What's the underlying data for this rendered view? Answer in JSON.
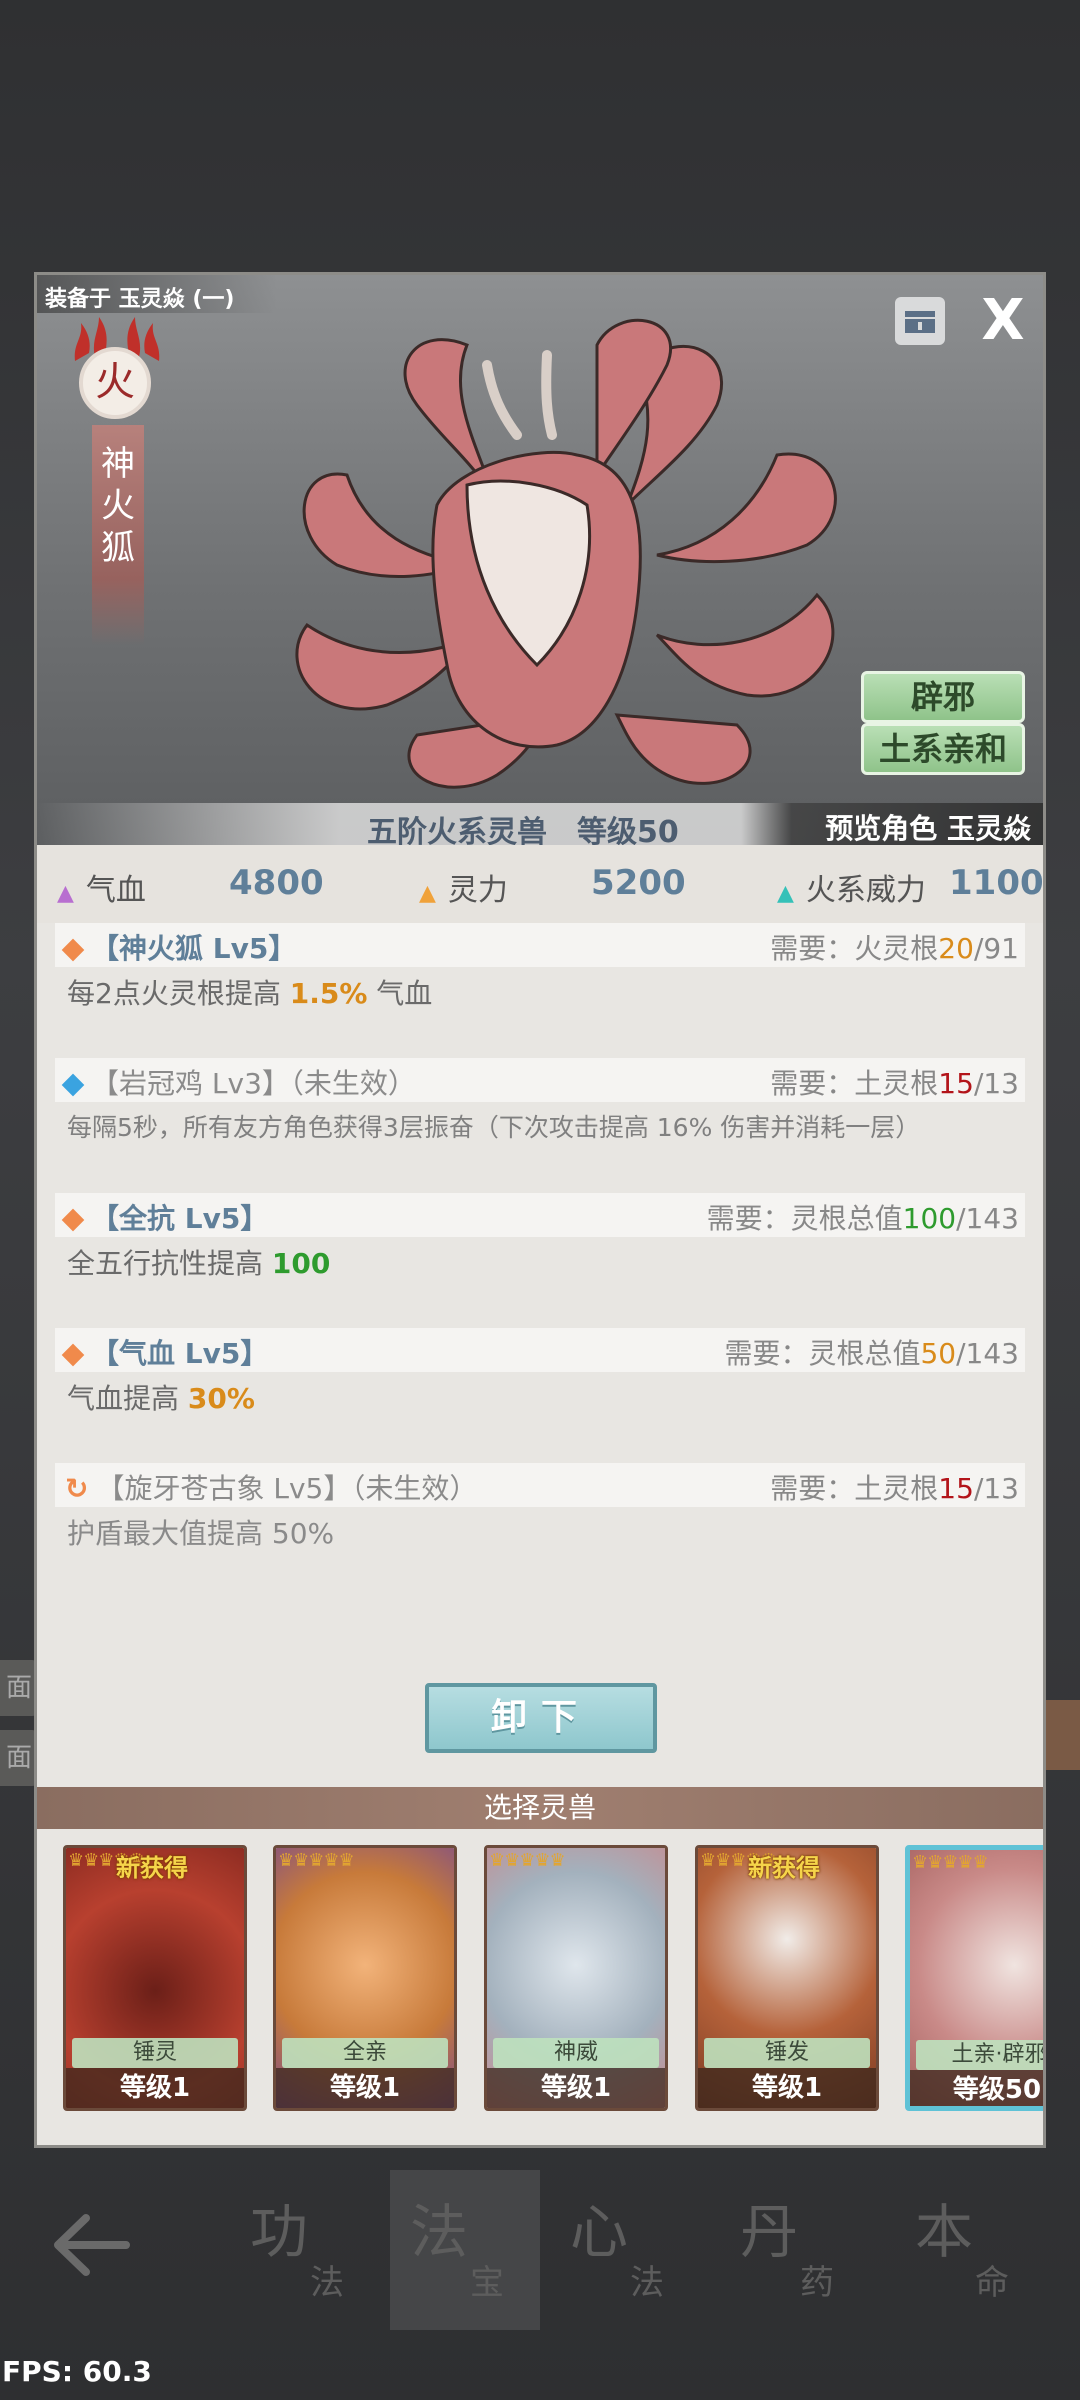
{
  "background": {
    "left_tabs": [
      "面",
      "面"
    ]
  },
  "bottom_nav": {
    "tabs": [
      {
        "big": "功",
        "small": "法"
      },
      {
        "big": "法",
        "small": "宝"
      },
      {
        "big": "心",
        "small": "法"
      },
      {
        "big": "丹",
        "small": "药"
      },
      {
        "big": "本",
        "small": "命"
      }
    ]
  },
  "fps": "FPS: 60.3",
  "modal": {
    "equipped_on": "装备于 玉灵焱 (一)",
    "close_glyph": "X",
    "element": "火",
    "beast_name_chars": [
      "神",
      "火",
      "狐"
    ],
    "traits": [
      "辟邪",
      "土系亲和"
    ],
    "rank_text": "五阶火系灵兽",
    "level_text": "等级50",
    "preview_role": "预览角色 玉灵焱"
  },
  "stats": [
    {
      "label": "气血",
      "value": "4800",
      "color": "#b86fd0"
    },
    {
      "label": "灵力",
      "value": "5200",
      "color": "#f0a23a"
    },
    {
      "label": "火系威力",
      "value": "1100",
      "color": "#35c1b8"
    }
  ],
  "skills": [
    {
      "name": "【神火狐 Lv5】",
      "inactive": "",
      "icon_color": "#f08a4b",
      "req_label": "需要：火灵根",
      "req_cur": "20",
      "req_max": "/91",
      "req_state": "ok",
      "desc_pre": "每2点火灵根提高 ",
      "desc_hl": "1.5%",
      "desc_post": " 气血",
      "hl_color": "orange"
    },
    {
      "name": "【岩冠鸡 Lv3】",
      "inactive": "（未生效）",
      "icon_color": "#3aa3e0",
      "req_label": "需要：土灵根",
      "req_cur": "15",
      "req_max": "/13",
      "req_state": "bad",
      "desc_pre": "每隔5秒，所有友方角色获得3层振奋（下次攻击提高 16% 伤害并消耗一层）",
      "desc_hl": "",
      "desc_post": "",
      "hl_color": "none"
    },
    {
      "name": "【全抗 Lv5】",
      "inactive": "",
      "icon_color": "#f08a4b",
      "req_label": "需要：灵根总值",
      "req_cur": "100",
      "req_max": "/143",
      "req_state": "green",
      "desc_pre": "全五行抗性提高 ",
      "desc_hl": "100",
      "desc_post": "",
      "hl_color": "green"
    },
    {
      "name": "【气血 Lv5】",
      "inactive": "",
      "icon_color": "#f08a4b",
      "req_label": "需要：灵根总值",
      "req_cur": "50",
      "req_max": "/143",
      "req_state": "ok",
      "desc_pre": "气血提高 ",
      "desc_hl": "30%",
      "desc_post": "",
      "hl_color": "orange"
    },
    {
      "name": "【旋牙苍古象 Lv5】",
      "inactive": "（未生效）",
      "icon_color": "#f08a4b",
      "req_label": "需要：土灵根",
      "req_cur": "15",
      "req_max": "/13",
      "req_state": "bad",
      "desc_pre": "护盾最大值提高 50%",
      "desc_hl": "",
      "desc_post": "",
      "hl_color": "none"
    }
  ],
  "unequip_label": "卸下",
  "select_title": "选择灵兽",
  "cards": [
    {
      "tag": "锤灵",
      "level": "等级1",
      "new": "新获得",
      "stars": "♛♛♛♛♛",
      "theme": "#8e2c22"
    },
    {
      "tag": "全亲",
      "level": "等级1",
      "new": "",
      "stars": "♛♛♛♛♛",
      "theme": "#c77a3a"
    },
    {
      "tag": "神威",
      "level": "等级1",
      "new": "",
      "stars": "♛♛♛♛♛",
      "theme": "#a3b1bd"
    },
    {
      "tag": "锤发",
      "level": "等级1",
      "new": "新获得",
      "stars": "♛♛♛♛♛",
      "theme": "#b5623a"
    },
    {
      "tag": "土亲·辟邪",
      "level": "等级50",
      "new": "",
      "stars": "♛♛♛♛♛",
      "theme": "#c98a88"
    }
  ]
}
